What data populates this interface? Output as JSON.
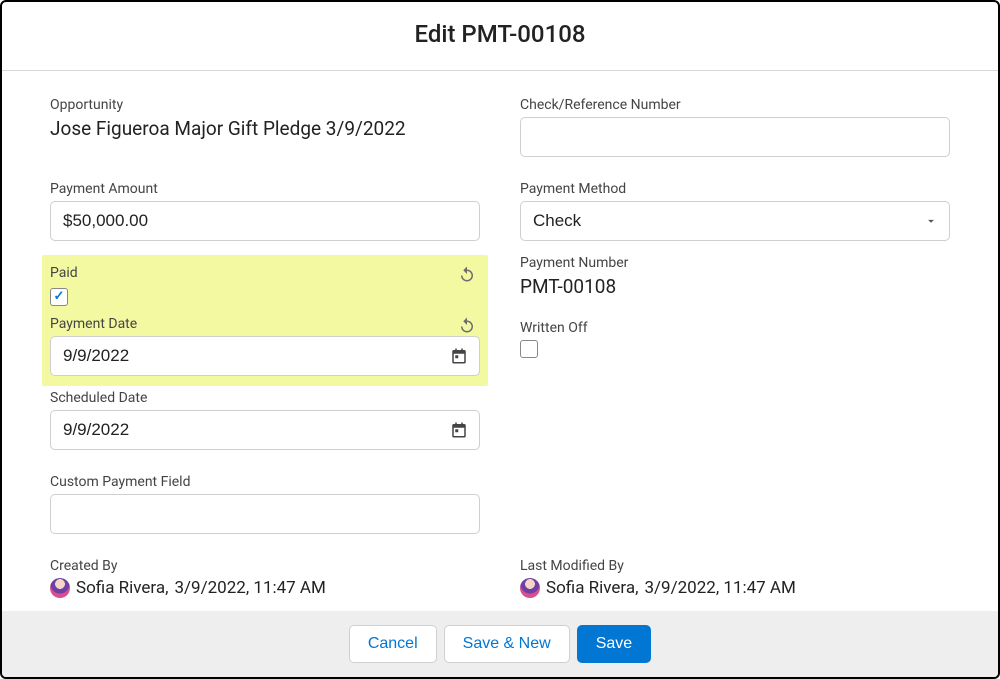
{
  "header": {
    "title": "Edit PMT-00108"
  },
  "fields": {
    "opportunity": {
      "label": "Opportunity",
      "value": "Jose Figueroa Major Gift Pledge 3/9/2022"
    },
    "check_reference": {
      "label": "Check/Reference Number",
      "value": ""
    },
    "payment_amount": {
      "label": "Payment Amount",
      "value": "$50,000.00"
    },
    "payment_method": {
      "label": "Payment Method",
      "value": "Check"
    },
    "paid": {
      "label": "Paid",
      "checked": true
    },
    "payment_number": {
      "label": "Payment Number",
      "value": "PMT-00108"
    },
    "payment_date": {
      "label": "Payment Date",
      "value": "9/9/2022"
    },
    "written_off": {
      "label": "Written Off",
      "checked": false
    },
    "scheduled_date": {
      "label": "Scheduled Date",
      "value": "9/9/2022"
    },
    "custom_payment_field": {
      "label": "Custom Payment Field",
      "value": ""
    },
    "created_by": {
      "label": "Created By",
      "user": "Sofia Rivera",
      "date": "3/9/2022, 11:47 AM"
    },
    "last_modified_by": {
      "label": "Last Modified By",
      "user": "Sofia Rivera",
      "date": "3/9/2022, 11:47 AM"
    }
  },
  "footer": {
    "cancel": "Cancel",
    "save_new": "Save & New",
    "save": "Save"
  }
}
